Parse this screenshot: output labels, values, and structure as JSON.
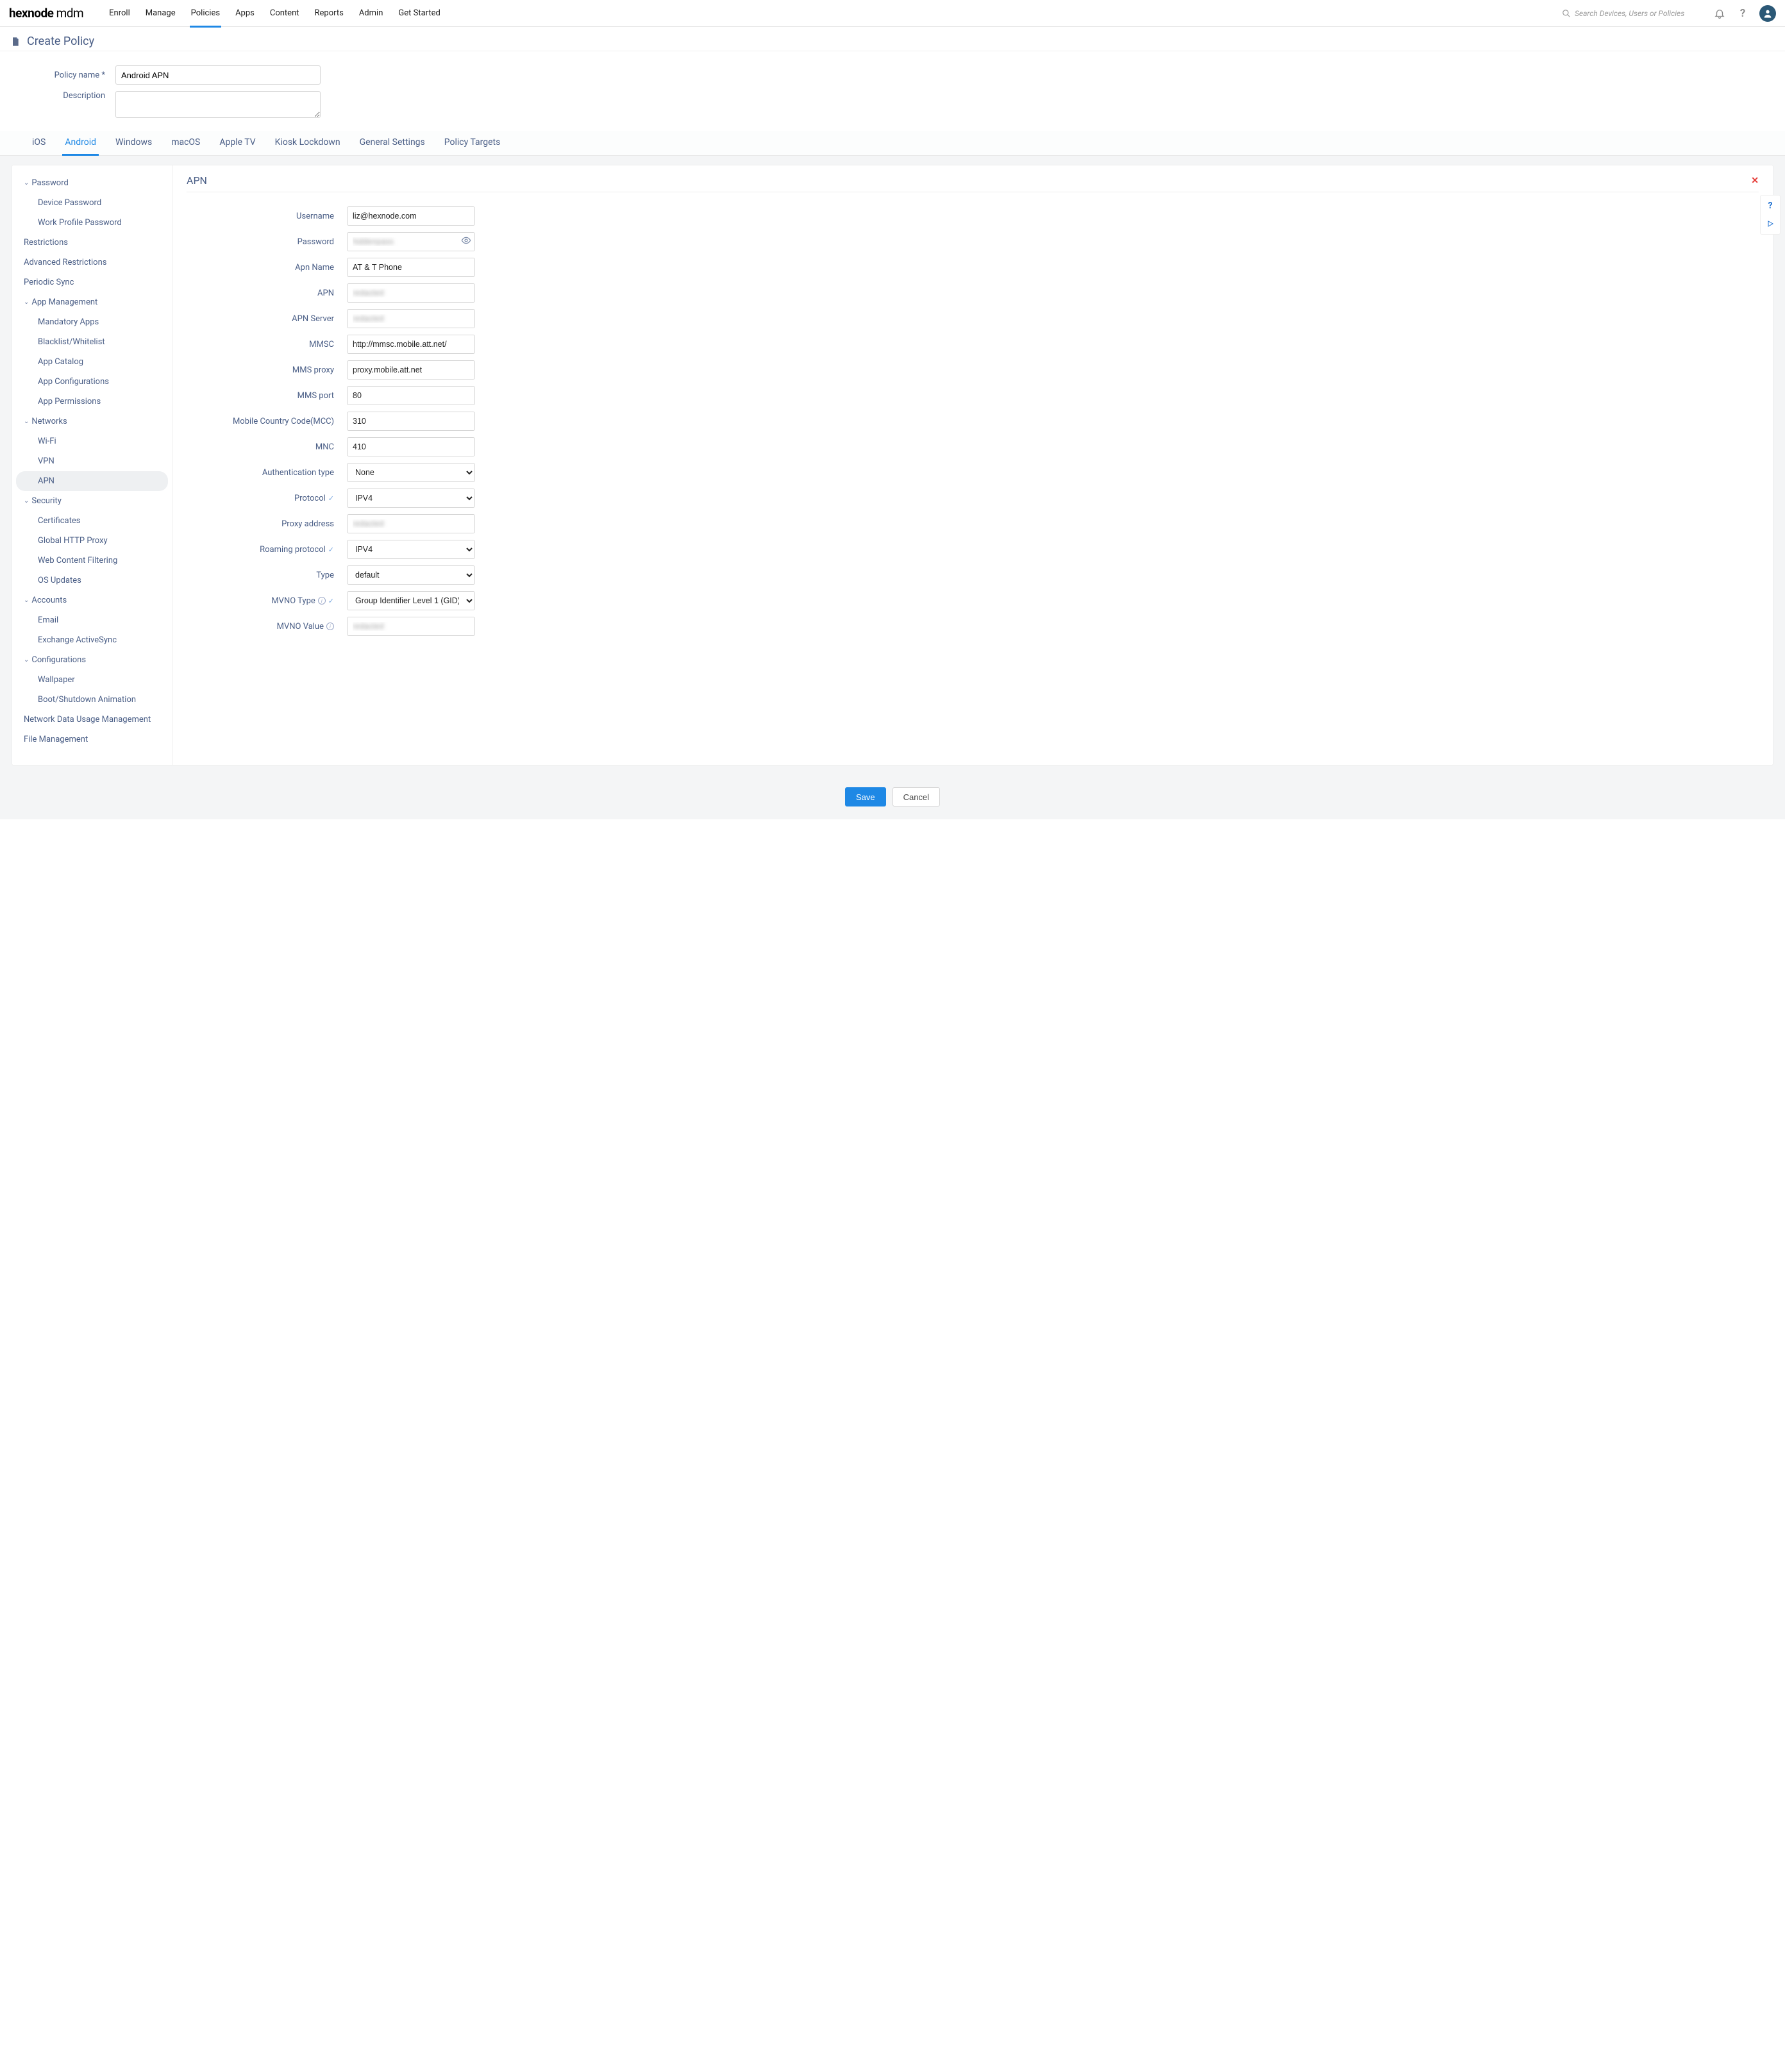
{
  "brand": {
    "bold": "hexnode",
    "rest": " mdm"
  },
  "topnav": [
    "Enroll",
    "Manage",
    "Policies",
    "Apps",
    "Content",
    "Reports",
    "Admin",
    "Get Started"
  ],
  "topnav_active": "Policies",
  "search": {
    "placeholder": "Search Devices, Users or Policies"
  },
  "page": {
    "title": "Create Policy"
  },
  "policy_form": {
    "name_label": "Policy name *",
    "name_value": "Android APN",
    "desc_label": "Description",
    "desc_value": ""
  },
  "tabs": [
    "iOS",
    "Android",
    "Windows",
    "macOS",
    "Apple TV",
    "Kiosk Lockdown",
    "General Settings",
    "Policy Targets"
  ],
  "tabs_active": "Android",
  "sidebar": [
    {
      "type": "group",
      "label": "Password",
      "items": [
        "Device Password",
        "Work Profile Password"
      ]
    },
    {
      "type": "single",
      "label": "Restrictions"
    },
    {
      "type": "single",
      "label": "Advanced Restrictions"
    },
    {
      "type": "single",
      "label": "Periodic Sync"
    },
    {
      "type": "group",
      "label": "App Management",
      "items": [
        "Mandatory Apps",
        "Blacklist/Whitelist",
        "App Catalog",
        "App Configurations",
        "App Permissions"
      ]
    },
    {
      "type": "group",
      "label": "Networks",
      "items": [
        "Wi-Fi",
        "VPN",
        "APN"
      ]
    },
    {
      "type": "group",
      "label": "Security",
      "items": [
        "Certificates",
        "Global HTTP Proxy",
        "Web Content Filtering",
        "OS Updates"
      ]
    },
    {
      "type": "group",
      "label": "Accounts",
      "items": [
        "Email",
        "Exchange ActiveSync"
      ]
    },
    {
      "type": "group",
      "label": "Configurations",
      "items": [
        "Wallpaper",
        "Boot/Shutdown Animation"
      ]
    },
    {
      "type": "single",
      "label": "Network Data Usage Management"
    },
    {
      "type": "single",
      "label": "File Management"
    }
  ],
  "sidebar_active": "APN",
  "section": {
    "title": "APN"
  },
  "fields": {
    "username": {
      "label": "Username",
      "value": "liz@hexnode.com",
      "kind": "text"
    },
    "password": {
      "label": "Password",
      "value": "hiddenpass",
      "kind": "password",
      "blurred": true,
      "eye": true
    },
    "apn_name": {
      "label": "Apn Name",
      "value": "AT & T Phone",
      "kind": "text"
    },
    "apn": {
      "label": "APN",
      "value": "redacted",
      "kind": "text",
      "blurred": true
    },
    "apn_server": {
      "label": "APN Server",
      "value": "redacted",
      "kind": "text",
      "blurred": true
    },
    "mmsc": {
      "label": "MMSC",
      "value": "http://mmsc.mobile.att.net/",
      "kind": "text"
    },
    "mms_proxy": {
      "label": "MMS proxy",
      "value": "proxy.mobile.att.net",
      "kind": "text"
    },
    "mms_port": {
      "label": "MMS port",
      "value": "80",
      "kind": "text"
    },
    "mcc": {
      "label": "Mobile Country Code(MCC)",
      "value": "310",
      "kind": "text"
    },
    "mnc": {
      "label": "MNC",
      "value": "410",
      "kind": "text"
    },
    "auth_type": {
      "label": "Authentication type",
      "value": "None",
      "kind": "select",
      "options": [
        "None"
      ]
    },
    "protocol": {
      "label": "Protocol",
      "value": "IPV4",
      "kind": "select",
      "options": [
        "IPV4"
      ],
      "check": true
    },
    "proxy_addr": {
      "label": "Proxy address",
      "value": "redacted",
      "kind": "text",
      "blurred": true
    },
    "roaming": {
      "label": "Roaming protocol",
      "value": "IPV4",
      "kind": "select",
      "options": [
        "IPV4"
      ],
      "check": true
    },
    "type": {
      "label": "Type",
      "value": "default",
      "kind": "select",
      "options": [
        "default"
      ]
    },
    "mvno_type": {
      "label": "MVNO Type",
      "value": "Group Identifier Level 1 (GID)",
      "kind": "select",
      "options": [
        "Group Identifier Level 1 (GID)"
      ],
      "info": true,
      "check": true
    },
    "mvno_value": {
      "label": "MVNO Value",
      "value": "redacted",
      "kind": "text",
      "blurred": true,
      "info": true
    }
  },
  "footer": {
    "save": "Save",
    "cancel": "Cancel"
  }
}
